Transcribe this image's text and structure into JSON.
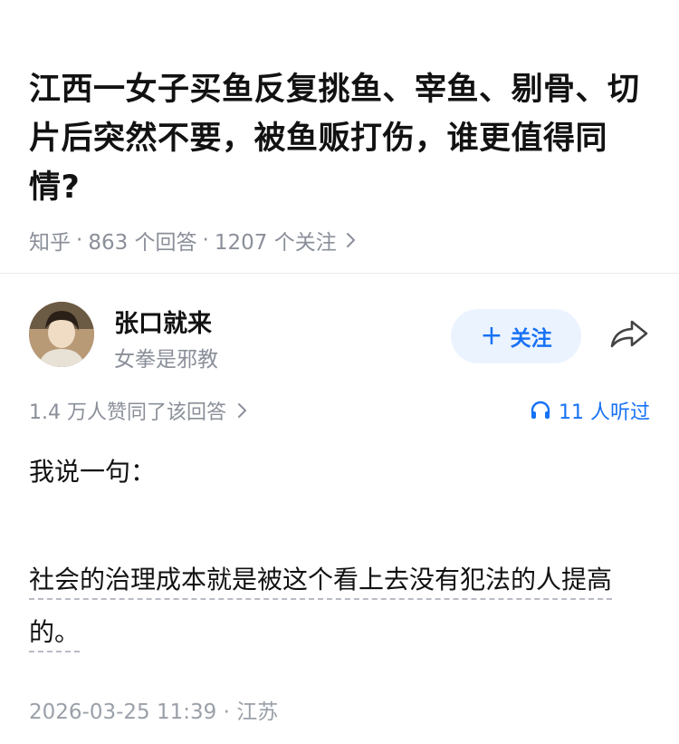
{
  "question": {
    "title": "江西一女子买鱼反复挑鱼、宰鱼、剔骨、切片后突然不要，被鱼贩打伤，谁更值得同情?",
    "source": "知乎",
    "answers_count": "863 个回答",
    "followers_count": "1207 个关注"
  },
  "author": {
    "name": "张口就来",
    "bio": "女拳是邪教",
    "follow_label": "关注",
    "avatar_icon": "avatar-photo",
    "share_icon": "share-icon"
  },
  "stats": {
    "agree_text": "1.4 万人赞同了该回答",
    "listen_text": "11 人听过"
  },
  "answer": {
    "paragraph1": "我说一句：",
    "paragraph2": "社会的治理成本就是被这个看上去没有犯法的人提高的。"
  },
  "footer": {
    "datetime": "2026-03-25 11:39",
    "location": "江苏"
  },
  "colors": {
    "accent": "#1772f6",
    "follow_bg": "#ebf3ff",
    "muted": "#8a8f99",
    "text": "#121212"
  }
}
